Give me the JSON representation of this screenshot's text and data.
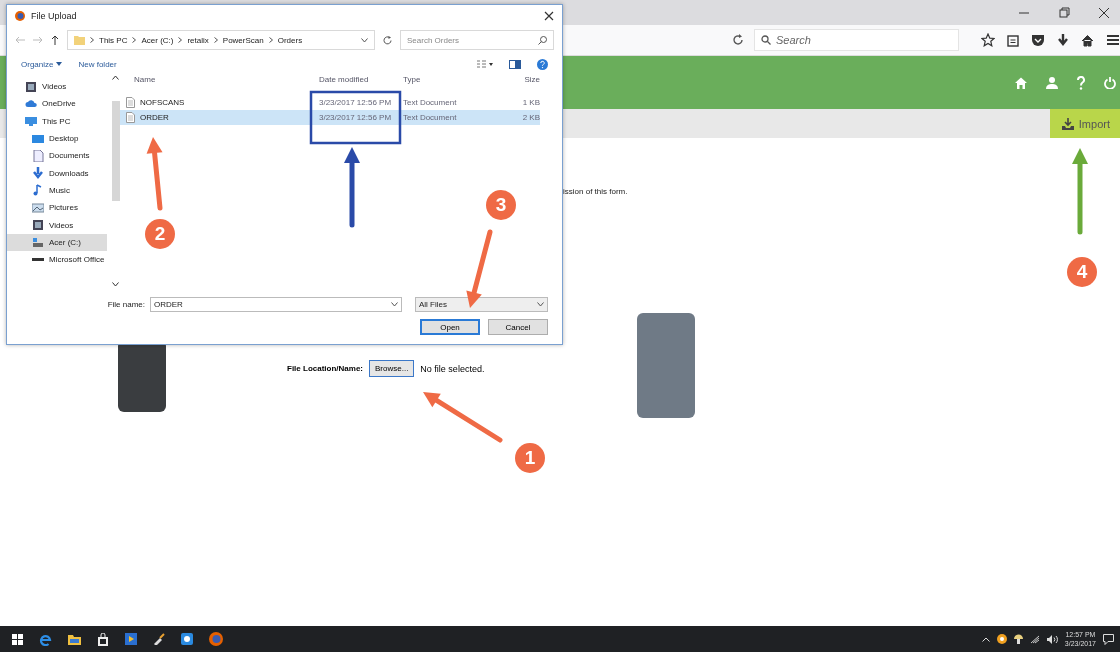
{
  "browser": {
    "search_placeholder": "Search",
    "import_button": "Import",
    "form_note": "ission of this form.",
    "file_label": "File Location/Name:",
    "browse_button": "Browse...",
    "file_status": "No file selected."
  },
  "dialog": {
    "title": "File Upload",
    "breadcrumb": [
      "This PC",
      "Acer (C:)",
      "retalix",
      "PowerScan",
      "Orders"
    ],
    "search_placeholder": "Search Orders",
    "organize": "Organize",
    "new_folder": "New folder",
    "nav": [
      {
        "label": "Videos",
        "kind": "video",
        "selected": false
      },
      {
        "label": "OneDrive",
        "kind": "cloud",
        "selected": false
      },
      {
        "label": "This PC",
        "kind": "pc",
        "selected": false,
        "children": [
          {
            "label": "Desktop",
            "kind": "desktop",
            "selected": false
          },
          {
            "label": "Documents",
            "kind": "doc",
            "selected": false
          },
          {
            "label": "Downloads",
            "kind": "download",
            "selected": false
          },
          {
            "label": "Music",
            "kind": "music",
            "selected": false
          },
          {
            "label": "Pictures",
            "kind": "picture",
            "selected": false
          },
          {
            "label": "Videos",
            "kind": "video",
            "selected": false
          },
          {
            "label": "Acer (C:)",
            "kind": "drive",
            "selected": true
          },
          {
            "label": "Microsoft Office",
            "kind": "disk",
            "selected": false
          }
        ]
      }
    ],
    "columns": [
      "Name",
      "Date modified",
      "Type",
      "Size"
    ],
    "rows": [
      {
        "name": "NOFSCANS",
        "date": "3/23/2017 12:56 PM",
        "type": "Text Document",
        "size": "1 KB",
        "selected": false
      },
      {
        "name": "ORDER",
        "date": "3/23/2017 12:56 PM",
        "type": "Text Document",
        "size": "2 KB",
        "selected": true
      }
    ],
    "file_name_label": "File name:",
    "file_name": "ORDER",
    "file_type": "All Files",
    "buttons": [
      "Open",
      "Cancel"
    ]
  },
  "annotations": {
    "markers": [
      {
        "label": "1",
        "color": "#ef6a45"
      },
      {
        "label": "2",
        "color": "#ef6a45"
      },
      {
        "label": "3",
        "color": "#ef6a45"
      },
      {
        "label": "4",
        "color": "#ef6a45"
      }
    ],
    "arrows": [
      {
        "color": "#ef6a45"
      },
      {
        "color": "#2a4aa8"
      },
      {
        "color": "#ef6a45"
      },
      {
        "color": "#ef6a45"
      },
      {
        "color": "#6aaa3a"
      }
    ],
    "highlight": {
      "color": "#2a4aa8"
    }
  },
  "taskbar": {
    "time": "12:57 PM",
    "date": "3/23/2017"
  }
}
